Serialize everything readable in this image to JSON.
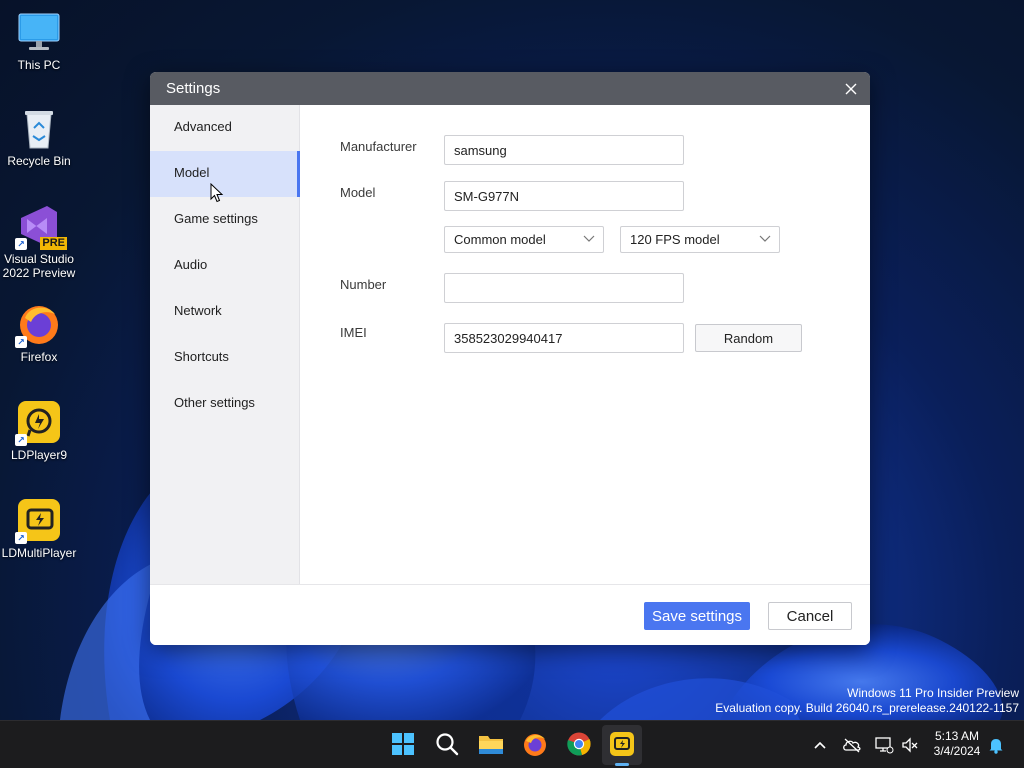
{
  "desktop": {
    "icons": [
      {
        "label": "This PC"
      },
      {
        "label": "Recycle Bin"
      },
      {
        "label": "Visual Studio 2022 Preview",
        "badge": "PRE"
      },
      {
        "label": "Firefox"
      },
      {
        "label": "LDPlayer9"
      },
      {
        "label": "LDMultiPlayer"
      }
    ]
  },
  "dialog": {
    "title": "Settings",
    "sidebar": {
      "items": [
        {
          "label": "Advanced"
        },
        {
          "label": "Model",
          "active": true
        },
        {
          "label": "Game settings"
        },
        {
          "label": "Audio"
        },
        {
          "label": "Network"
        },
        {
          "label": "Shortcuts"
        },
        {
          "label": "Other settings"
        }
      ]
    },
    "form": {
      "manufacturer_label": "Manufacturer",
      "manufacturer_value": "samsung",
      "model_label": "Model",
      "model_value": "SM-G977N",
      "model_type_select": "Common model",
      "fps_select": "120 FPS model",
      "number_label": "Number",
      "number_value": "",
      "imei_label": "IMEI",
      "imei_value": "358523029940417",
      "random_label": "Random"
    },
    "footer": {
      "save_label": "Save settings",
      "cancel_label": "Cancel"
    }
  },
  "watermark": {
    "line1": "Windows 11 Pro Insider Preview",
    "line2": "Evaluation copy. Build 26040.rs_prerelease.240122-1157"
  },
  "taskbar": {
    "apps": [
      "start-icon",
      "search-icon",
      "file-explorer-icon",
      "firefox-icon",
      "chrome-icon",
      "ldplayer-icon"
    ],
    "clock_time": "5:13 AM",
    "clock_date": "3/4/2024"
  },
  "colors": {
    "accent": "#4a76f0",
    "sidebar_active": "#d7e1fb",
    "titlebar": "#585b62",
    "taskbar": "#1c1c1e"
  }
}
